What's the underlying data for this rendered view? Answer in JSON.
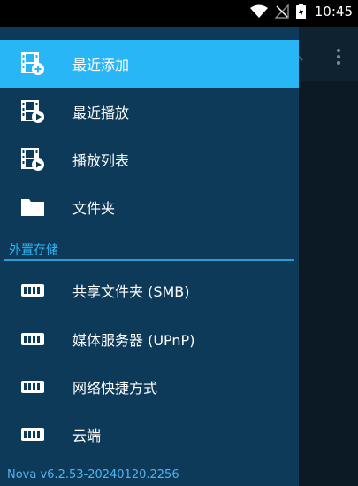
{
  "status": {
    "time": "10:45"
  },
  "drawer": {
    "items": [
      {
        "label": "最近添加",
        "icon": "film-add-icon",
        "active": true
      },
      {
        "label": "最近播放",
        "icon": "film-play-icon"
      },
      {
        "label": "播放列表",
        "icon": "film-play-icon"
      },
      {
        "label": "文件夹",
        "icon": "folder-icon"
      }
    ],
    "section_title": "外置存储",
    "storage_items": [
      {
        "label": "共享文件夹 (SMB)",
        "icon": "nas-icon"
      },
      {
        "label": "媒体服务器 (UPnP)",
        "icon": "nas-icon"
      },
      {
        "label": "网络快捷方式",
        "icon": "nas-icon"
      },
      {
        "label": "云端",
        "icon": "nas-icon"
      }
    ],
    "version": "Nova v6.2.53-20240120.2256"
  },
  "colors": {
    "drawer_bg": "#0e3a5a",
    "accent": "#29b6f6",
    "text": "#ffffff"
  }
}
